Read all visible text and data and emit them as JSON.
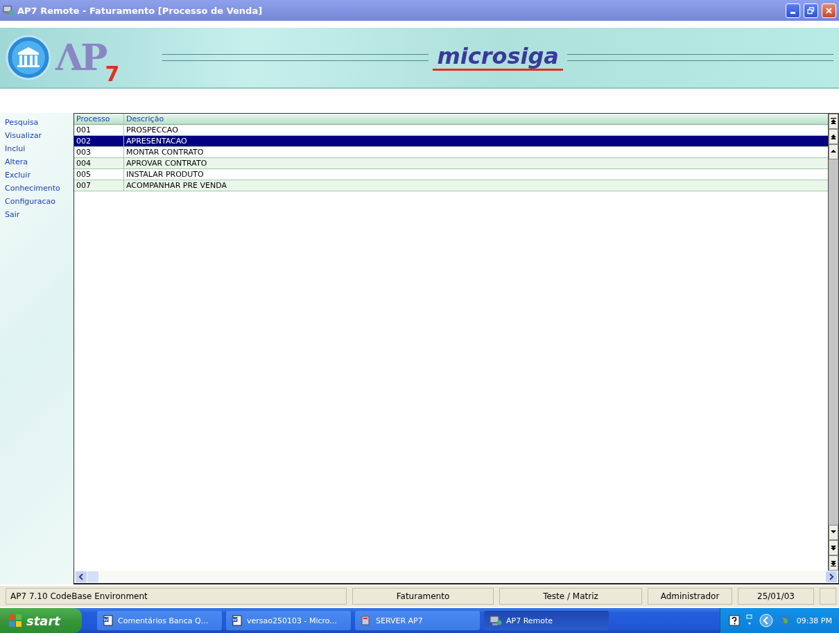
{
  "window": {
    "title": "AP7 Remote - Faturamento [Processo de Venda]"
  },
  "header": {
    "logo_text": "ΛP",
    "logo_subscript": "7",
    "brand": "microsiga"
  },
  "menu": [
    {
      "label": "Pesquisa"
    },
    {
      "label": "Visualizar"
    },
    {
      "label": "Inclui"
    },
    {
      "label": "Altera"
    },
    {
      "label": "Excluir"
    },
    {
      "label": "Conhecimento"
    },
    {
      "label": "Configuracao"
    },
    {
      "label": "Sair"
    }
  ],
  "table": {
    "columns": [
      "Processo",
      "Descrição"
    ],
    "rows": [
      {
        "cells": [
          "001",
          "PROSPECCAO"
        ],
        "selected": false
      },
      {
        "cells": [
          "002",
          "APRESENTACAO"
        ],
        "selected": true
      },
      {
        "cells": [
          "003",
          "MONTAR CONTRATO"
        ],
        "selected": false
      },
      {
        "cells": [
          "004",
          "APROVAR CONTRATO"
        ],
        "selected": false
      },
      {
        "cells": [
          "005",
          "INSTALAR PRODUTO"
        ],
        "selected": false
      },
      {
        "cells": [
          "007",
          "ACOMPANHAR PRE VENDA"
        ],
        "selected": false
      }
    ]
  },
  "status_bar": [
    "AP7 7.10  CodeBase Environment",
    "Faturamento",
    "Teste / Matriz",
    "Administrador",
    "25/01/03"
  ],
  "taskbar": {
    "start": "start",
    "tasks": [
      {
        "label": "Comentários Banca Q...",
        "kind": "word",
        "selected": false
      },
      {
        "label": "versao250103 - Micro...",
        "kind": "word",
        "selected": false
      },
      {
        "label": "SERVER AP7",
        "kind": "server",
        "selected": false
      },
      {
        "label": "AP7 Remote",
        "kind": "remote",
        "selected": true
      }
    ],
    "time": "09:38 PM"
  }
}
